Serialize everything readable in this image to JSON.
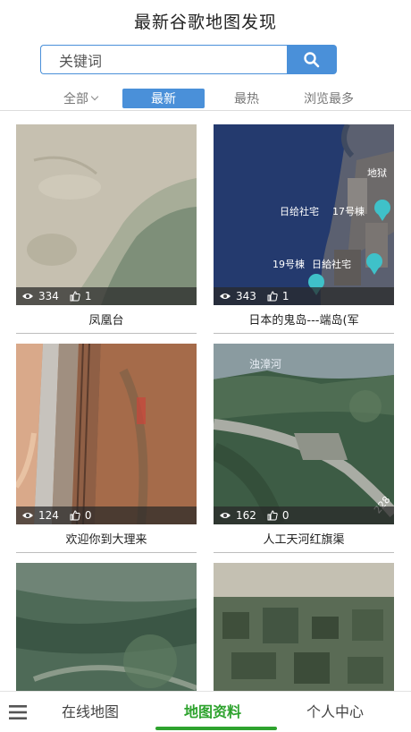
{
  "header": {
    "title": "最新谷歌地图发现"
  },
  "search": {
    "placeholder": "关键词"
  },
  "filters": [
    {
      "label": "全部",
      "active": false
    },
    {
      "label": "最新",
      "active": true
    },
    {
      "label": "最热",
      "active": false
    },
    {
      "label": "浏览最多",
      "active": false
    }
  ],
  "cards": [
    {
      "title": "凤凰台",
      "views": "334",
      "likes": "1"
    },
    {
      "title": "日本的鬼岛---端岛(军",
      "views": "343",
      "likes": "1"
    },
    {
      "title": "欢迎你到大理来",
      "views": "124",
      "likes": "0"
    },
    {
      "title": "人工天河红旗渠",
      "views": "162",
      "likes": "0"
    }
  ],
  "map_labels": {
    "card2": [
      "地狱",
      "日给社宅",
      "17号棟",
      "19号棟",
      "日給社宅"
    ],
    "card4": [
      "浊漳河",
      "228"
    ]
  },
  "tabbar": {
    "tabs": [
      {
        "label": "在线地图",
        "active": false
      },
      {
        "label": "地图资料",
        "active": true
      },
      {
        "label": "个人中心",
        "active": false
      }
    ]
  },
  "colors": {
    "accent": "#4a90d9",
    "tab_active": "#2ea32e"
  }
}
